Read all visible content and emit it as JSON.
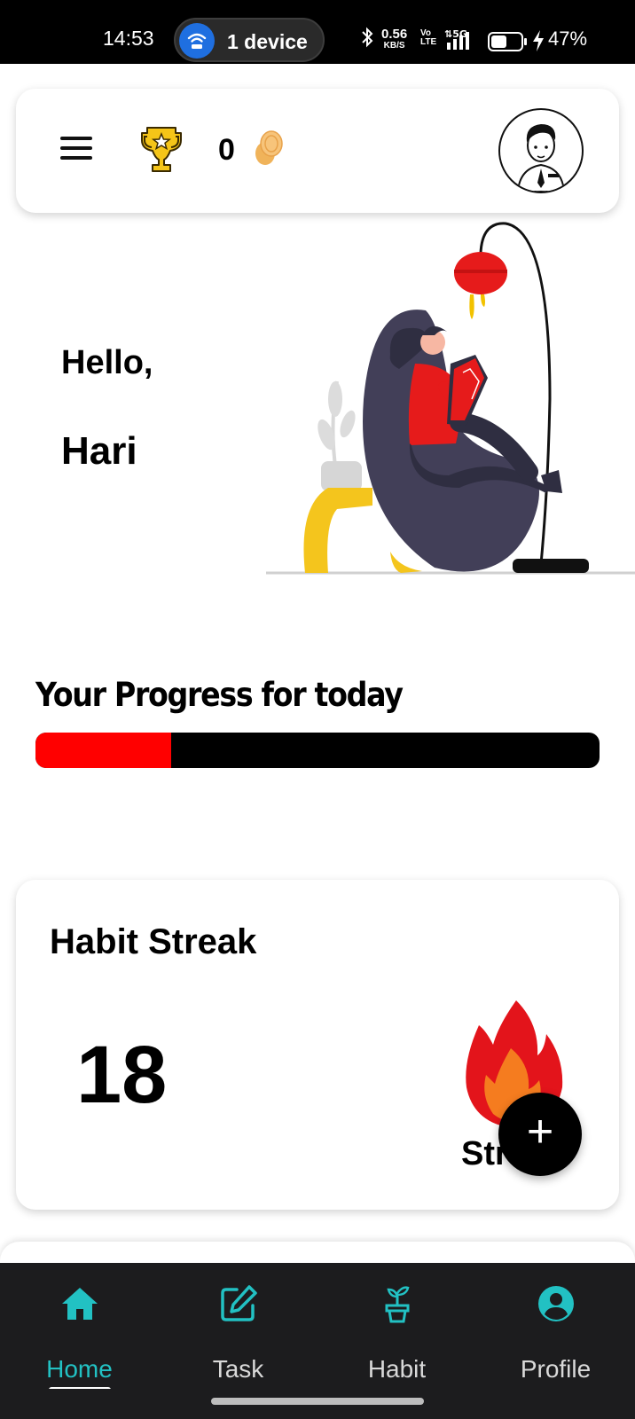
{
  "status_bar": {
    "time": "14:53",
    "hotspot_label": "1 device",
    "net_speed_value": "0.56",
    "net_speed_unit": "KB/S",
    "volte_top": "Vo",
    "volte_bottom": "LTE",
    "network": "5G",
    "battery": "47%"
  },
  "header": {
    "menu_icon": "hamburger-menu-icon",
    "trophy_icon": "trophy-icon",
    "coins": "0",
    "coin_icon": "coin-icon",
    "avatar_icon": "avatar-icon"
  },
  "greeting": {
    "hello": "Hello,",
    "name": "Hari"
  },
  "progress": {
    "title": "Your Progress for today",
    "fraction": 0.24,
    "fill_color": "#ff0000",
    "track_color": "#000000"
  },
  "streak": {
    "title": "Habit Streak",
    "count": "18",
    "label": "Str",
    "fab_label": "+"
  },
  "bottom_nav": {
    "active_color": "#22c1c3",
    "items": [
      {
        "label": "Home",
        "icon": "home-icon",
        "active": true
      },
      {
        "label": "Task",
        "icon": "edit-icon",
        "active": false
      },
      {
        "label": "Habit",
        "icon": "plant-icon",
        "active": false
      },
      {
        "label": "Profile",
        "icon": "profile-icon",
        "active": false
      }
    ]
  }
}
